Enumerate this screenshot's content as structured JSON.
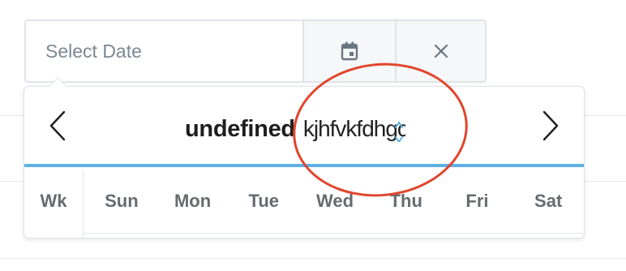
{
  "date_field": {
    "placeholder": "Select Date",
    "value": ""
  },
  "icons": {
    "calendar": "calendar-icon",
    "clear": "close-icon",
    "prev": "chevron-left-icon",
    "next": "chevron-right-icon",
    "year_spinner": "spinner-arrows-icon"
  },
  "calendar": {
    "month_label": "undefined",
    "year_value": "kjhfvkfdhgc",
    "week_header": "Wk",
    "weekdays": [
      "Sun",
      "Mon",
      "Tue",
      "Wed",
      "Thu",
      "Fri",
      "Sat"
    ]
  },
  "colors": {
    "accent_underline": "#5eb0e5",
    "annotation": "#e0452c",
    "addon_background": "#f5f7f9",
    "border": "#dfe3e8"
  }
}
